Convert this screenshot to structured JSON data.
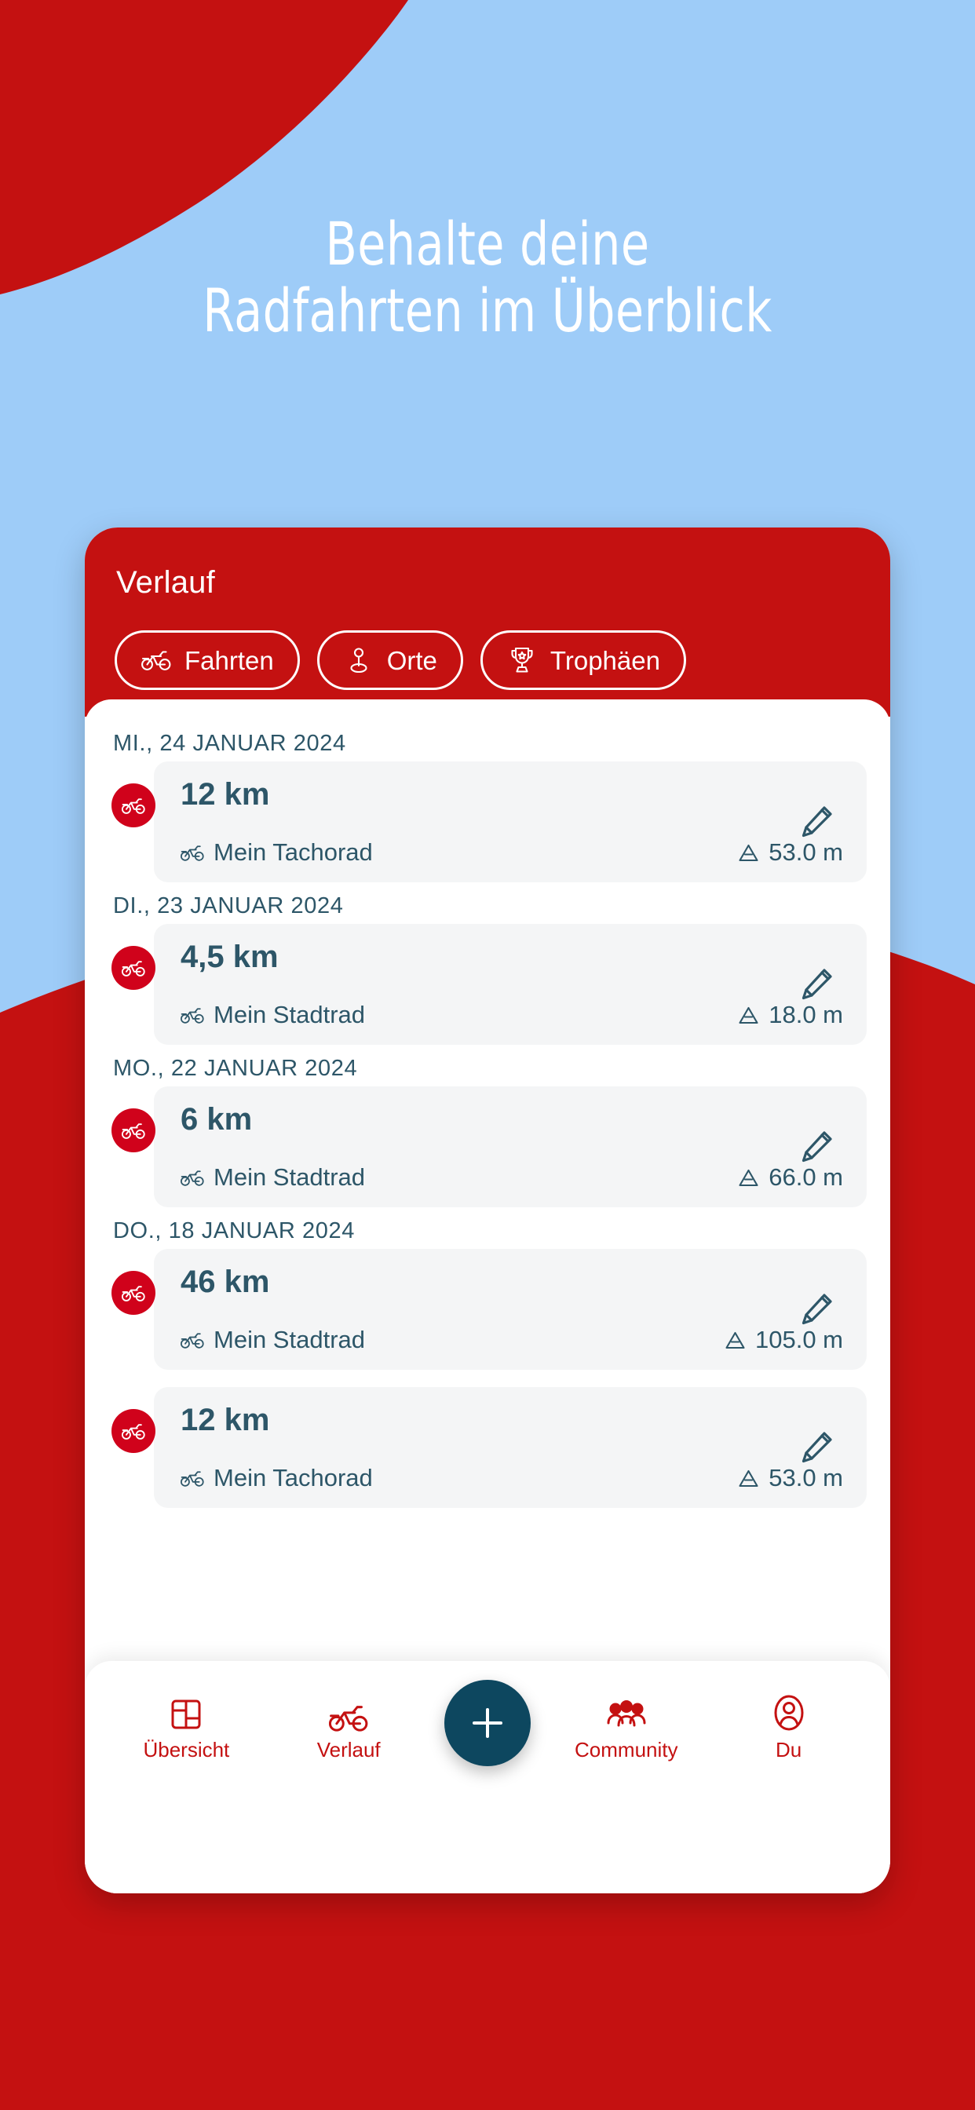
{
  "colors": {
    "brand_red": "#c41111",
    "badge_red": "#d0021b",
    "sky_blue": "#9ECCF8",
    "teal_dark": "#0d475f",
    "text_teal": "#2d5668",
    "card_grey": "#f4f5f6",
    "white": "#ffffff"
  },
  "headline": {
    "line1": "Behalte deine",
    "line2": "Radfahrten im Überblick"
  },
  "phone": {
    "header": {
      "title": "Verlauf",
      "chips": [
        {
          "label": "Fahrten",
          "icon": "bicycle-icon"
        },
        {
          "label": "Orte",
          "icon": "location-pin-icon"
        },
        {
          "label": "Trophäen",
          "icon": "trophy-icon"
        }
      ]
    },
    "history": [
      {
        "date": "MI., 24 JANUAR 2024",
        "rides": [
          {
            "distance": "12 km",
            "bike": "Mein Tachorad",
            "elevation": "53.0 m",
            "badge_icon": "bicycle-icon",
            "bike_icon": "bicycle-icon",
            "elevation_icon": "mountain-icon",
            "edit_icon": "pencil-icon"
          }
        ]
      },
      {
        "date": "DI., 23 JANUAR 2024",
        "rides": [
          {
            "distance": "4,5 km",
            "bike": "Mein Stadtrad",
            "elevation": "18.0 m",
            "badge_icon": "bicycle-icon",
            "bike_icon": "bicycle-icon",
            "elevation_icon": "mountain-icon",
            "edit_icon": "pencil-icon"
          }
        ]
      },
      {
        "date": "MO., 22 JANUAR 2024",
        "rides": [
          {
            "distance": "6 km",
            "bike": "Mein Stadtrad",
            "elevation": "66.0 m",
            "badge_icon": "bicycle-icon",
            "bike_icon": "bicycle-icon",
            "elevation_icon": "mountain-icon",
            "edit_icon": "pencil-icon"
          }
        ]
      },
      {
        "date": "DO., 18 JANUAR 2024",
        "rides": [
          {
            "distance": "46 km",
            "bike": "Mein Stadtrad",
            "elevation": "105.0 m",
            "badge_icon": "bicycle-icon",
            "bike_icon": "bicycle-icon",
            "elevation_icon": "mountain-icon",
            "edit_icon": "pencil-icon"
          },
          {
            "distance": "12 km",
            "bike": "Mein Tachorad",
            "elevation": "53.0 m",
            "badge_icon": "bicycle-icon",
            "bike_icon": "bicycle-icon",
            "elevation_icon": "mountain-icon",
            "edit_icon": "pencil-icon"
          }
        ]
      }
    ],
    "bottom_nav": {
      "items": [
        {
          "label": "Übersicht",
          "icon": "dashboard-grid-icon"
        },
        {
          "label": "Verlauf",
          "icon": "bicycle-icon"
        },
        {
          "label": "Community",
          "icon": "people-group-icon"
        },
        {
          "label": "Du",
          "icon": "user-profile-icon"
        }
      ],
      "fab": {
        "label": "+",
        "icon": "plus-icon"
      }
    }
  }
}
